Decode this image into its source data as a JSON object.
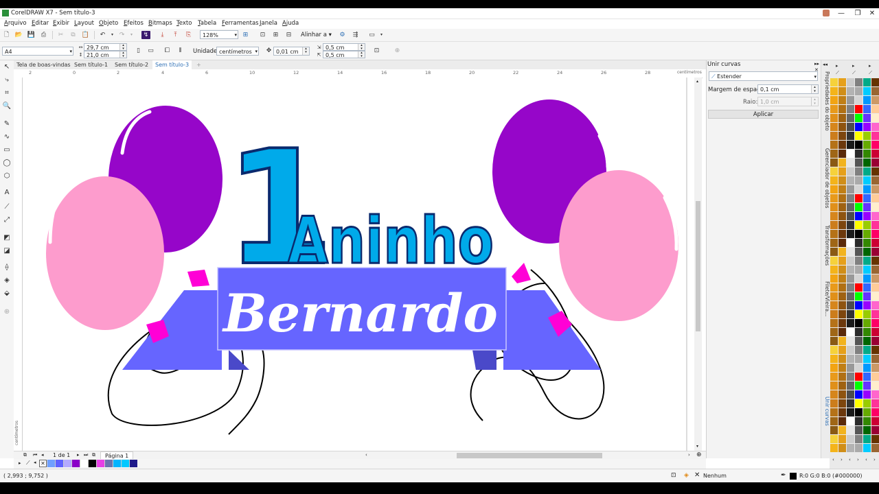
{
  "window": {
    "title": "CorelDRAW X7 - Sem título-3",
    "controls": [
      "—",
      "❐",
      "✕"
    ]
  },
  "menu": [
    "Arquivo",
    "Editar",
    "Exibir",
    "Layout",
    "Objeto",
    "Efeitos",
    "Bitmaps",
    "Texto",
    "Tabela",
    "Ferramentas",
    "Janela",
    "Ajuda"
  ],
  "toolbar": {
    "zoom": "128%",
    "align_label": "Alinhar a",
    "icons": [
      "new-icon",
      "open-icon",
      "save-icon",
      "print-icon",
      "cut-icon",
      "copy-icon",
      "paste-icon",
      "undo-icon",
      "redo-icon",
      "import-icon",
      "export-icon"
    ]
  },
  "property_bar": {
    "page_size": "A4",
    "width": "29,7 cm",
    "height": "21,0 cm",
    "units_label": "Unidades:",
    "units_value": "centímetros",
    "nudge": "0,01 cm",
    "dup_x": "0,5 cm",
    "dup_y": "0,5 cm"
  },
  "tabs": [
    {
      "label": "Tela de boas-vindas",
      "active": false
    },
    {
      "label": "Sem título-1",
      "active": false
    },
    {
      "label": "Sem título-2",
      "active": false
    },
    {
      "label": "Sem título-3",
      "active": true
    }
  ],
  "ruler": {
    "top_numbers": [
      "2",
      "0",
      "2",
      "4",
      "6",
      "8",
      "10",
      "12",
      "14",
      "16",
      "18",
      "20",
      "22",
      "24",
      "26",
      "28"
    ],
    "unit": "centímetros"
  },
  "artwork": {
    "big_number": "1",
    "word": "Aninho",
    "name": "Bernardo",
    "colors": {
      "purple": "#9606c9",
      "pink": "#fd9ccd",
      "blue": "#00aaea",
      "ribbon": "#6665ff",
      "magenta": "#ff00d6",
      "outline": "#0a2a6e"
    }
  },
  "page_nav": {
    "counter": "1 de 1",
    "page_tab": "Página 1"
  },
  "docker": {
    "title": "Unir curvas",
    "mode": "Estender",
    "gap_label": "Margem de espaço:",
    "gap_value": "0,1 cm",
    "radius_label": "Raio:",
    "radius_value": "1,0 cm",
    "apply": "Aplicar"
  },
  "docker_tabs": [
    "Propriedades do objeto",
    "Gerenciador de objetos",
    "Transformações",
    "Filete/Vieira...",
    "Unir curvas"
  ],
  "doc_palette": [
    "#6fa0ff",
    "#5f62ff",
    "#b3a9ff",
    "#8a00c8",
    "#ffffff",
    "#000000",
    "#e63fe6",
    "#6a72b0",
    "#00b4ff",
    "#00c8ff",
    "#1f1a8a"
  ],
  "status": {
    "coords": "( 2,993 ; 9,752 )",
    "fill": "Nenhum",
    "outline": "R:0 G:0 B:0 (#000000)"
  }
}
